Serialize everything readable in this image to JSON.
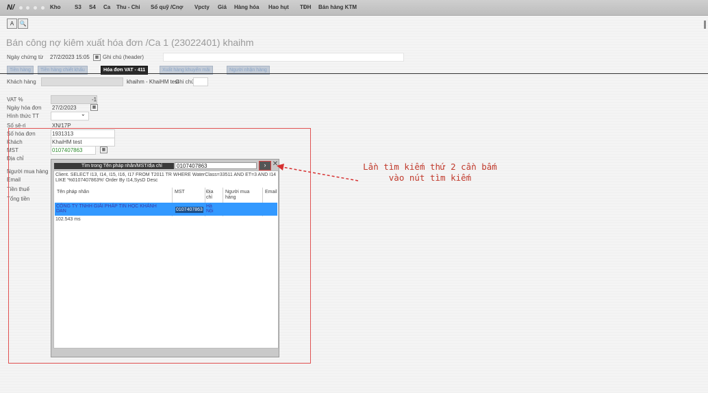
{
  "app": {
    "logo": "N/",
    "menu": [
      "Kho",
      "S3",
      "S4",
      "Ca",
      "Thu - Chi",
      "Sổ quỹ /Cnợ",
      "Vpcty",
      "Giá",
      "Hàng hóa",
      "Hao hụt",
      "TĐH",
      "Bán hàng KTM"
    ]
  },
  "toolbar": {
    "export_icon": "A",
    "search_icon": "🔍"
  },
  "page": {
    "title": "Bán công nợ kiêm xuất hóa đơn /Ca 1 (23022401) khaihm",
    "voucher_date_label": "Ngày chứng từ",
    "voucher_date_value": "27/2/2023 15:05",
    "header_note_label": "Ghi chú (header)"
  },
  "tabs": [
    "Tiền hàng",
    "Tiền hàng chiết khấu",
    "Hóa đơn VAT - 411",
    "Xuất hàng khuyến mãi",
    "Người nhận hàng"
  ],
  "customer": {
    "label": "Khách hàng",
    "value": "khaihm - KhaiHM test",
    "note_label": "Ghi chú"
  },
  "form": {
    "vat_label": "VAT %",
    "vat_value": "-1",
    "invoice_date_label": "Ngày hóa đơn",
    "invoice_date_value": "27/2/2023",
    "payment_label": "Hình thức TT",
    "series_label": "Số sê-ri",
    "series_value": "XN/17P",
    "invoice_no_label": "Số hóa đơn",
    "invoice_no_value": "1931313",
    "customer_label": "Khách",
    "customer_value": "KhaiHM test",
    "tax_label": "MST",
    "tax_value": "0107407863",
    "address_label": "Địa chỉ",
    "buyer_label": "Người mua hàng",
    "email_label": "Email",
    "tax_amount_label": "Tiền thuế",
    "total_label": "Tổng tiền"
  },
  "popup": {
    "search_label": "Tìm trong Tên pháp nhân/MST/địa chỉ",
    "search_value": "0107407863",
    "search_button": "›",
    "close": "✕",
    "sql": "Client. SELECT I13, I14, I15, I16, I17 FROM T2011 TR WHERE WaterClass=33511 AND ET=3 AND I14 LIKE '%0107407863%' Order By I14,SysD Desc",
    "columns": [
      "Tên pháp nhân",
      "MST",
      "Địa chỉ",
      "Người mua hàng",
      "Email"
    ],
    "row": {
      "name": "CÔNG TY TNHH GIẢI PHÁP TIN HỌC KHÁNH DAN",
      "mst": "0107407863",
      "address": "Hà Nội"
    },
    "elapsed": "102.543 ms"
  },
  "annotation": "Lần tìm kiếm thứ 2 cần bấm vào nút tìm kiếm",
  "colors": {
    "annotation": "#c0392b",
    "highlight_row": "#3399ff",
    "active_tab": "#2a2a2a"
  }
}
